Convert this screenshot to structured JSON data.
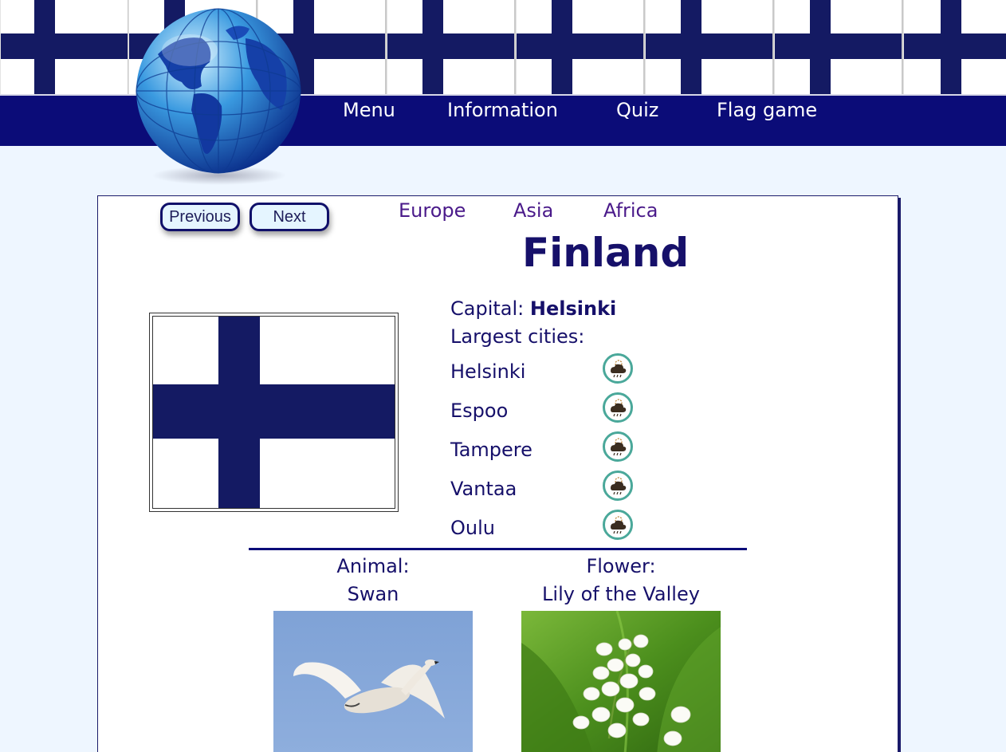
{
  "nav": {
    "items": [
      {
        "label": "Menu"
      },
      {
        "label": "Information"
      },
      {
        "label": "Quiz"
      },
      {
        "label": "Flag game"
      }
    ]
  },
  "buttons": {
    "previous": "Previous",
    "next": "Next"
  },
  "continents": [
    "Europe",
    "Asia",
    "Africa"
  ],
  "country": {
    "name": "Finland",
    "capital_label": "Capital:",
    "capital": "Helsinki",
    "largest_cities_label": "Largest cities:",
    "cities": [
      "Helsinki",
      "Espoo",
      "Tampere",
      "Vantaa",
      "Oulu"
    ],
    "animal_label": "Animal:",
    "animal": "Swan",
    "flower_label": "Flower:",
    "flower": "Lily of the Valley"
  },
  "colors": {
    "flag_blue": "#141a63",
    "nav_background": "#0b0c78",
    "page_background": "#eef6ff",
    "text_dark_blue": "#16106a",
    "continent_purple": "#4a1a8a"
  },
  "icons": {
    "weather": "weather-cloud-rain-icon",
    "globe": "globe-icon"
  }
}
